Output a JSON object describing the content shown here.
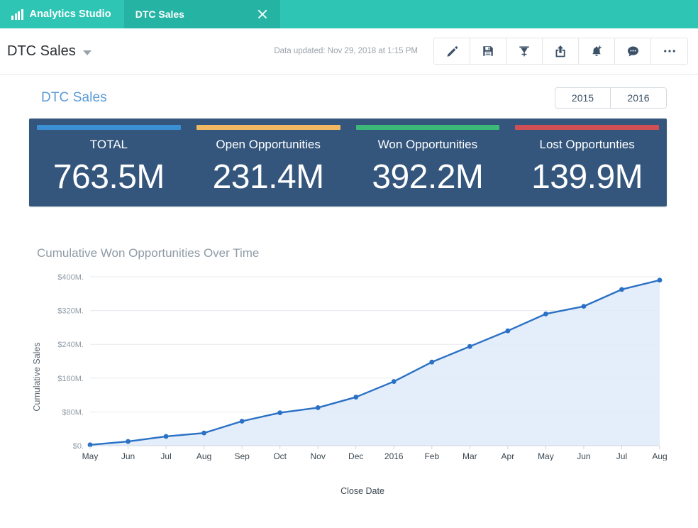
{
  "app": {
    "brand_label": "Analytics Studio",
    "brand_icon": "bar-chart-logo-icon",
    "tab_title": "DTC Sales",
    "tab_close_icon": "close-icon",
    "tabbar_color": "#2fc5b5",
    "tab_active_color": "#25b3a4"
  },
  "header": {
    "doc_title": "DTC Sales",
    "dropdown_icon": "chevron-down-icon",
    "updated_text": "Data updated: Nov 29, 2018 at 1:15 PM",
    "toolbar": [
      {
        "name": "edit-button",
        "icon": "pencil-icon"
      },
      {
        "name": "save-button",
        "icon": "floppy-disk-icon"
      },
      {
        "name": "clip-button",
        "icon": "bookmark-clip-icon"
      },
      {
        "name": "share-button",
        "icon": "share-export-icon"
      },
      {
        "name": "subscribe-button",
        "icon": "bell-plus-icon"
      },
      {
        "name": "comments-button",
        "icon": "chat-bubble-icon"
      },
      {
        "name": "more-button",
        "icon": "ellipsis-icon"
      }
    ]
  },
  "dashboard": {
    "title": "DTC Sales",
    "title_color": "#5b9bd5",
    "year_toggle": [
      "2015",
      "2016"
    ],
    "panel_bg": "#34567c",
    "kpis": [
      {
        "label": "TOTAL",
        "value": "763.5M",
        "color": "#3b8fd4"
      },
      {
        "label": "Open Opportunities",
        "value": "231.4M",
        "color": "#f0b862"
      },
      {
        "label": "Won Opportunities",
        "value": "392.2M",
        "color": "#3cb878"
      },
      {
        "label": "Lost Opportunties",
        "value": "139.9M",
        "color": "#cf4f54"
      }
    ]
  },
  "chart_data": {
    "type": "area",
    "title": "Cumulative Won Opportunities Over Time",
    "xlabel": "Close Date",
    "ylabel": "Cumulative Sales",
    "categories": [
      "May",
      "Jun",
      "Jul",
      "Aug",
      "Sep",
      "Oct",
      "Nov",
      "Dec",
      "2016",
      "Feb",
      "Mar",
      "Apr",
      "May",
      "Jun",
      "Jul",
      "Aug"
    ],
    "values": [
      2,
      10,
      22,
      30,
      58,
      78,
      90,
      115,
      152,
      198,
      235,
      272,
      312,
      330,
      370,
      392
    ],
    "ylim": [
      0,
      400
    ],
    "yticks": [
      0,
      80,
      160,
      240,
      320,
      400
    ],
    "ytick_labels": [
      "$0.",
      "$80M.",
      "$160M.",
      "$240M.",
      "$320M.",
      "$400M."
    ],
    "grid": true,
    "legend": "none",
    "line_color": "#2a71c5",
    "fill_color": "#dfeaf9",
    "marker_color": "#2a71c5"
  }
}
